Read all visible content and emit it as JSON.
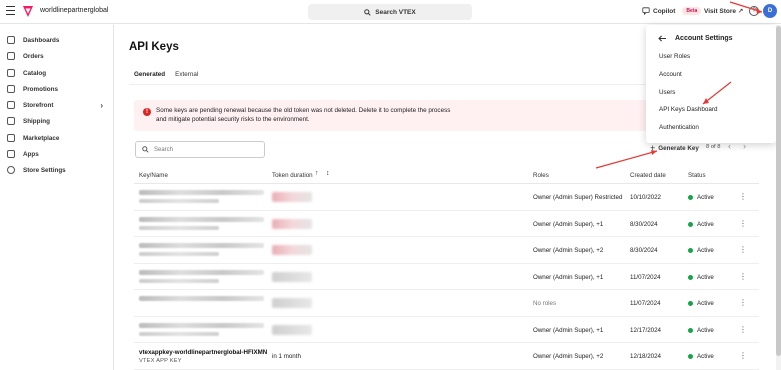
{
  "topbar": {
    "account": "worldlinepartnerglobal",
    "search": "Search VTEX",
    "copilot": "Copilot",
    "beta": "Beta",
    "visit_store": "Visit Store ↗",
    "help": "?",
    "avatar": "D"
  },
  "sidebar": {
    "items": [
      {
        "label": "Dashboards",
        "icon": "dashboard-icon"
      },
      {
        "label": "Orders",
        "icon": "cart-icon"
      },
      {
        "label": "Catalog",
        "icon": "tag-icon"
      },
      {
        "label": "Promotions",
        "icon": "megaphone-icon"
      },
      {
        "label": "Storefront",
        "icon": "storefront-icon"
      },
      {
        "label": "Shipping",
        "icon": "truck-icon"
      },
      {
        "label": "Marketplace",
        "icon": "share-icon"
      },
      {
        "label": "Apps",
        "icon": "apps-icon"
      },
      {
        "label": "Store Settings",
        "icon": "gear-icon"
      }
    ],
    "chevron": "›"
  },
  "main": {
    "title": "API Keys",
    "tabs": [
      {
        "label": "Generated"
      },
      {
        "label": "External"
      }
    ],
    "alert": "Some keys are pending renewal because the old token was not deleted. Delete it to complete the process and mitigate potential security risks to the environment.",
    "search_placeholder": "Search",
    "generate_key": "Generate Key",
    "pager": "8 of 8",
    "prev": "‹",
    "next": "›",
    "columns": {
      "key": "Key/Name",
      "duration": "Token duration",
      "roles": "Roles",
      "created": "Created date",
      "status": "Status"
    },
    "rows": [
      {
        "roles": "Owner (Admin Super) Restricted",
        "date": "10/10/2022",
        "status": "Active"
      },
      {
        "roles": "Owner (Admin Super), +1",
        "date": "8/30/2024",
        "status": "Active"
      },
      {
        "roles": "Owner (Admin Super), +2",
        "date": "8/30/2024",
        "status": "Active"
      },
      {
        "roles": "Owner (Admin Super), +1",
        "date": "11/07/2024",
        "status": "Active"
      },
      {
        "roles": "No roles",
        "date": "11/07/2024",
        "status": "Active"
      },
      {
        "roles": "Owner (Admin Super), +1",
        "date": "12/17/2024",
        "status": "Active"
      },
      {
        "name": "vtexappkey-worldlinepartnerglobal-HFIXMN",
        "sub": "VTEX APP KEY",
        "duration": "in 1 month",
        "roles": "Owner (Admin Super), +2",
        "date": "12/18/2024",
        "status": "Active"
      }
    ]
  },
  "dropdown": {
    "title": "Account Settings",
    "items": [
      "User Roles",
      "Account",
      "Users",
      "API Keys Dashboard",
      "Authentication"
    ]
  },
  "colors": {
    "accent": "#1a56db",
    "error": "#dc2626",
    "success": "#16a34a",
    "annotation": "#e53935",
    "brand": "#f71963"
  }
}
